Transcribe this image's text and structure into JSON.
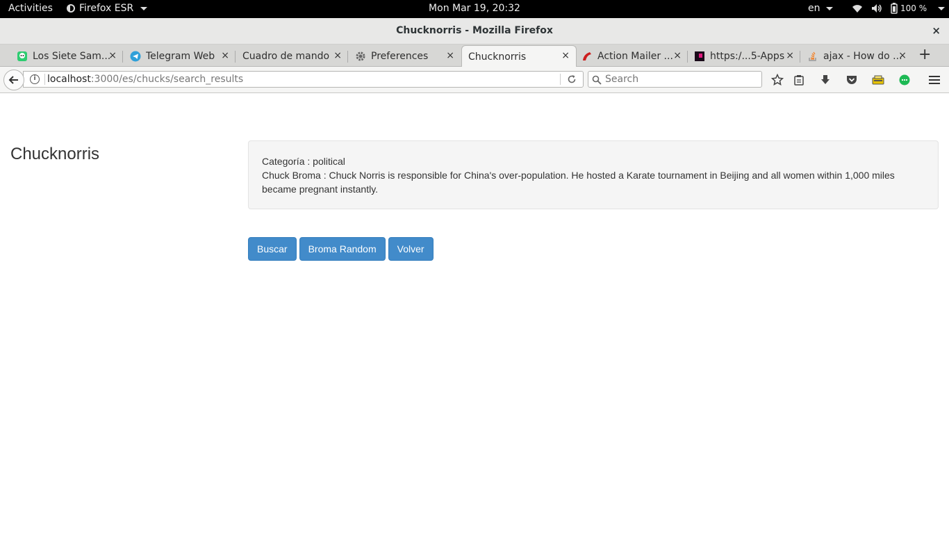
{
  "system_bar": {
    "activities": "Activities",
    "app_menu": "Firefox ESR",
    "clock": "Mon Mar 19, 20:32",
    "language": "en",
    "battery": "100 %"
  },
  "window": {
    "title": "Chucknorris - Mozilla Firefox",
    "close": "×"
  },
  "tabs": [
    {
      "label": "Los Siete Sam...",
      "icon": "ghost-favicon",
      "active": false
    },
    {
      "label": "Telegram Web",
      "icon": "telegram-favicon",
      "active": false
    },
    {
      "label": "Cuadro de mando",
      "icon": "none",
      "active": false
    },
    {
      "label": "Preferences",
      "icon": "gear-icon",
      "active": false
    },
    {
      "label": "Chucknorris",
      "icon": "none",
      "active": true
    },
    {
      "label": "Action Mailer ...",
      "icon": "rails-favicon",
      "active": false
    },
    {
      "label": "https:/...5-Apps",
      "icon": "square-favicon",
      "active": false
    },
    {
      "label": "ajax - How do ...",
      "icon": "stackoverflow-favicon",
      "active": false
    }
  ],
  "tab_close": "×",
  "new_tab": "+",
  "navbar": {
    "url_host": "localhost",
    "url_path": ":3000/es/chucks/search_results",
    "search_placeholder": "Search"
  },
  "page": {
    "brand": "Chucknorris",
    "category_line": "Categoría : political",
    "joke_line": "Chuck Broma : Chuck Norris is responsible for China's over-population. He hosted a Karate tournament in Beijing and all women within 1,000 miles became pregnant instantly.",
    "buttons": {
      "search": "Buscar",
      "random": "Broma Random",
      "back": "Volver"
    }
  },
  "colors": {
    "button_primary": "#428bca",
    "well_background": "#f5f5f5"
  }
}
